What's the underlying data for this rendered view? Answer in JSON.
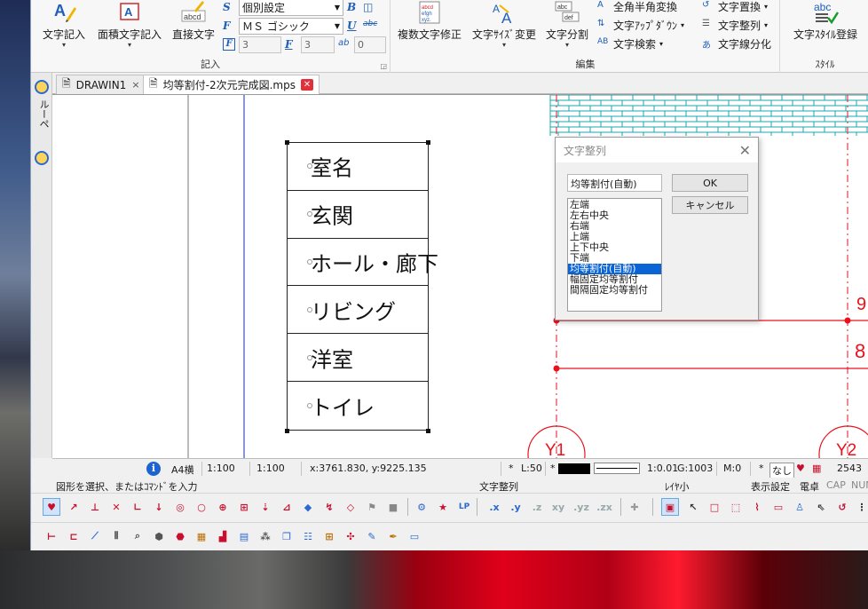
{
  "ribbon": {
    "groups": {
      "kinyu": "記入",
      "hensyu": "編集",
      "style": "ｽﾀｲﾙ"
    },
    "big_buttons": {
      "moji_kinyu": "文字記入",
      "menseki_moji": "面積文字記入",
      "chokusetsu_moji": "直接文字",
      "fukusu_moji": "複数文字修正",
      "moji_size": "文字ｻｲｽﾞ変更",
      "moji_bunkatsu": "文字分割",
      "moji_style_touroku": "文字ｽﾀｲﾙ登録"
    },
    "combos": {
      "style_combo": "個別設定",
      "font_combo": "ＭＳ ゴシック"
    },
    "fields": {
      "height_field": "3",
      "width_field": "3",
      "spacing_field": "0"
    },
    "small_buttons": {
      "zenkaku": "全角半角変換",
      "moji_updown": "文字ｱｯﾌﾟﾀﾞｳﾝ",
      "moji_kensaku": "文字検索",
      "moji_chikan": "文字置換",
      "moji_seiretsu": "文字整列",
      "moji_senbunka": "文字線分化"
    },
    "bold_glyph": "B",
    "underline_glyph": "U",
    "strike_glyph": "abc"
  },
  "sidestrip": {
    "label": "ルーペ"
  },
  "tabs": [
    {
      "label": "DRAWIN1",
      "close": "×"
    },
    {
      "label": "均等割付-2次元完成図.mps",
      "close": "✕"
    }
  ],
  "drawing": {
    "cells": [
      "室名",
      "玄関",
      "ホール・廊下",
      "リビング",
      "洋室",
      "トイレ"
    ],
    "right_labels": [
      "8",
      "Y1",
      "Y2"
    ]
  },
  "dialog": {
    "title": "文字整列",
    "close": "✕",
    "current_value": "均等割付(自動)",
    "options": [
      "左端",
      "左右中央",
      "右端",
      "上端",
      "上下中央",
      "下端",
      "均等割付(自動)",
      "幅固定均等割付",
      "間隔固定均等割付"
    ],
    "selected_index": 6,
    "ok_label": "OK",
    "cancel_label": "キャンセル"
  },
  "statusbar": {
    "info_icon": "i",
    "paper": "A4横",
    "scale1": "1:100",
    "scale2": "1:100",
    "coords": "x:3761.830, y:9225.135",
    "layer_star": "*",
    "layer": "L:50",
    "color_star": "*",
    "ratio": "1:0.01",
    "group": "G:1003",
    "mode": "M:0",
    "hatch_star": "*",
    "hatch": "なし",
    "count": "2543"
  },
  "messagebar": {
    "prompt": "図形を選択、またはｺﾏﾝﾄﾞを入力",
    "command": "文字整列",
    "layer_label": "ﾚｲﾔ小",
    "display": "表示設定",
    "calc": "電卓",
    "cap": "CAP",
    "num": "NUM"
  },
  "toolbar1": {
    "xyz_labels": [
      ".x",
      ".y",
      ".z",
      "xy",
      ".yz",
      ".zx"
    ]
  },
  "colors": {
    "accent": "#0a64d6",
    "drawing_red": "#e8121c",
    "hatch_teal": "#18a8b0",
    "dialog_bg": "#f0f0f0"
  }
}
